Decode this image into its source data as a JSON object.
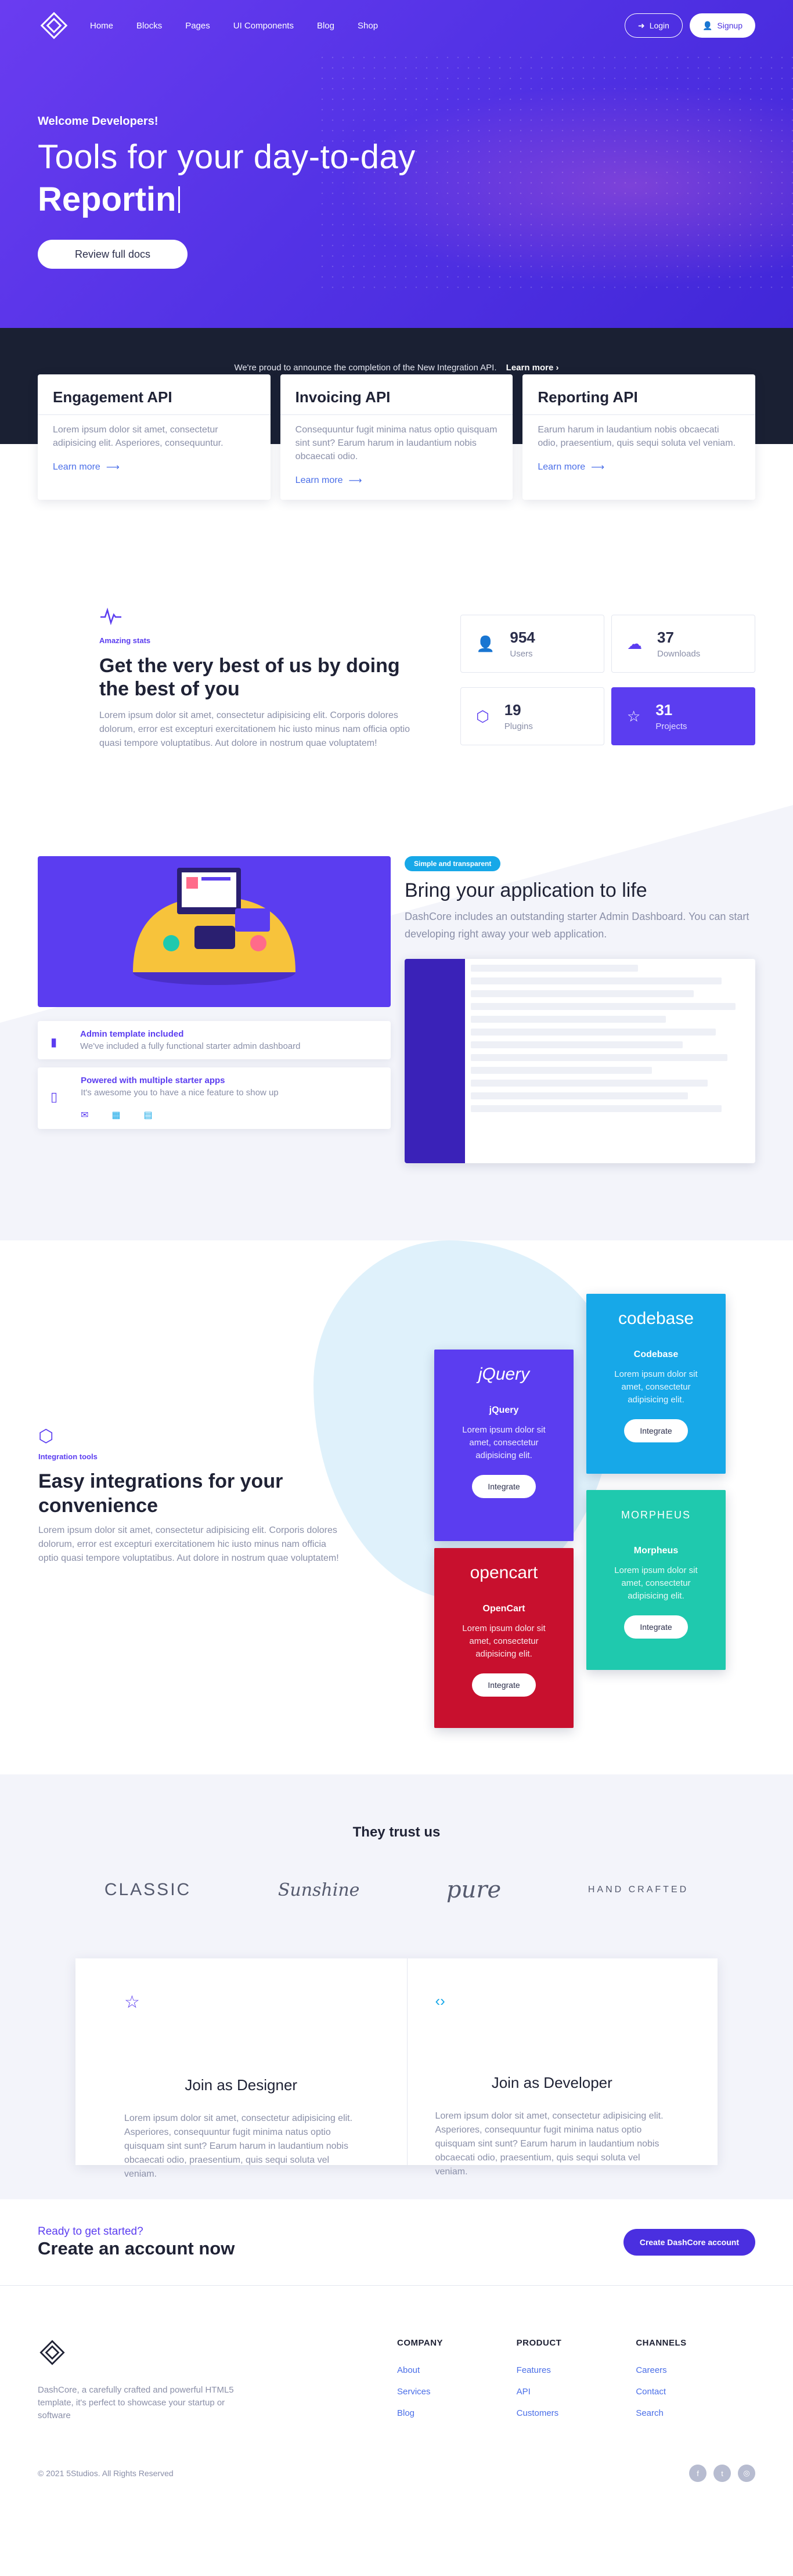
{
  "nav": {
    "links": [
      "Home",
      "Blocks",
      "Pages",
      "UI Components",
      "Blog",
      "Shop"
    ],
    "login": "Login",
    "signup": "Signup"
  },
  "hero": {
    "welcome": "Welcome Developers!",
    "line1": "Tools for your day-to-day",
    "line2": "Reportin",
    "cta": "Review full docs"
  },
  "announce": {
    "text": "We're proud to announce the completion of the New Integration API.",
    "link": "Learn more"
  },
  "api_cards": [
    {
      "title": "Engagement API",
      "body": "Lorem ipsum dolor sit amet, consectetur adipisicing elit. Asperiores, consequuntur.",
      "link": "Learn more"
    },
    {
      "title": "Invoicing API",
      "body": "Consequuntur fugit minima natus optio quisquam sint sunt? Earum harum in laudantium nobis obcaecati odio.",
      "link": "Learn more"
    },
    {
      "title": "Reporting API",
      "body": "Earum harum in laudantium nobis obcaecati odio, praesentium, quis sequi soluta vel veniam.",
      "link": "Learn more"
    }
  ],
  "stats": {
    "tag": "Amazing stats",
    "title": "Get the very best of us by doing the best of you",
    "body": "Lorem ipsum dolor sit amet, consectetur adipisicing elit. Corporis dolores dolorum, error est excepturi exercitationem hic iusto minus nam officia optio quasi tempore voluptatibus. Aut dolore in nostrum quae voluptatem!",
    "items": [
      {
        "num": "954",
        "label": "Users"
      },
      {
        "num": "37",
        "label": "Downloads"
      },
      {
        "num": "19",
        "label": "Plugins"
      },
      {
        "num": "31",
        "label": "Projects"
      }
    ]
  },
  "app": {
    "badge": "Simple and transparent",
    "title": "Bring your application to life",
    "body": "DashCore includes an outstanding starter Admin Dashboard. You can start developing right away your web application.",
    "feat1_title": "Admin template included",
    "feat1_desc": "We've included a fully functional starter admin dashboard",
    "feat2_title": "Powered with multiple starter apps",
    "feat2_desc": "It's awesome you to have a nice feature to show up"
  },
  "integrations": {
    "tag": "Integration tools",
    "title": "Easy integrations for your convenience",
    "body": "Lorem ipsum dolor sit amet, consectetur adipisicing elit. Corporis dolores dolorum, error est excepturi exercitationem hic iusto minus nam officia optio quasi tempore voluptatibus. Aut dolore in nostrum quae voluptatem!",
    "cards": [
      {
        "brand": "jQuery",
        "name": "jQuery",
        "body": "Lorem ipsum dolor sit amet, consectetur adipisicing elit.",
        "button": "Integrate",
        "color": "#5b3df0"
      },
      {
        "brand": "codebase",
        "name": "Codebase",
        "body": "Lorem ipsum dolor sit amet, consectetur adipisicing elit.",
        "button": "Integrate",
        "color": "#17a8e8"
      },
      {
        "brand": "opencart",
        "name": "OpenCart",
        "body": "Lorem ipsum dolor sit amet, consectetur adipisicing elit.",
        "button": "Integrate",
        "color": "#c8102e"
      },
      {
        "brand": "MORPHEUS",
        "name": "Morpheus",
        "body": "Lorem ipsum dolor sit amet, consectetur adipisicing elit.",
        "button": "Integrate",
        "color": "#1fc9ae"
      }
    ]
  },
  "trust": {
    "title": "They trust us",
    "logos": [
      "CLASSIC",
      "Sunshine",
      "pure",
      "HAND CRAFTED"
    ],
    "designer_title": "Join as Designer",
    "designer_body": "Lorem ipsum dolor sit amet, consectetur adipisicing elit. Asperiores, consequuntur fugit minima natus optio quisquam sint sunt? Earum harum in laudantium nobis obcaecati odio, praesentium, quis sequi soluta vel veniam.",
    "developer_title": "Join as Developer",
    "developer_body": "Lorem ipsum dolor sit amet, consectetur adipisicing elit. Asperiores, consequuntur fugit minima natus optio quisquam sint sunt? Earum harum in laudantium nobis obcaecati odio, praesentium, quis sequi soluta vel veniam."
  },
  "cta": {
    "small": "Ready to get started?",
    "big": "Create an account now",
    "button": "Create DashCore account"
  },
  "footer": {
    "about": "DashCore, a carefully crafted and powerful HTML5 template, it's perfect to showcase your startup or software",
    "columns": [
      {
        "title": "COMPANY",
        "links": [
          "About",
          "Services",
          "Blog"
        ]
      },
      {
        "title": "PRODUCT",
        "links": [
          "Features",
          "API",
          "Customers"
        ]
      },
      {
        "title": "CHANNELS",
        "links": [
          "Careers",
          "Contact",
          "Search"
        ]
      }
    ],
    "copyright": "© 2021 5Studios. All Rights Reserved"
  }
}
